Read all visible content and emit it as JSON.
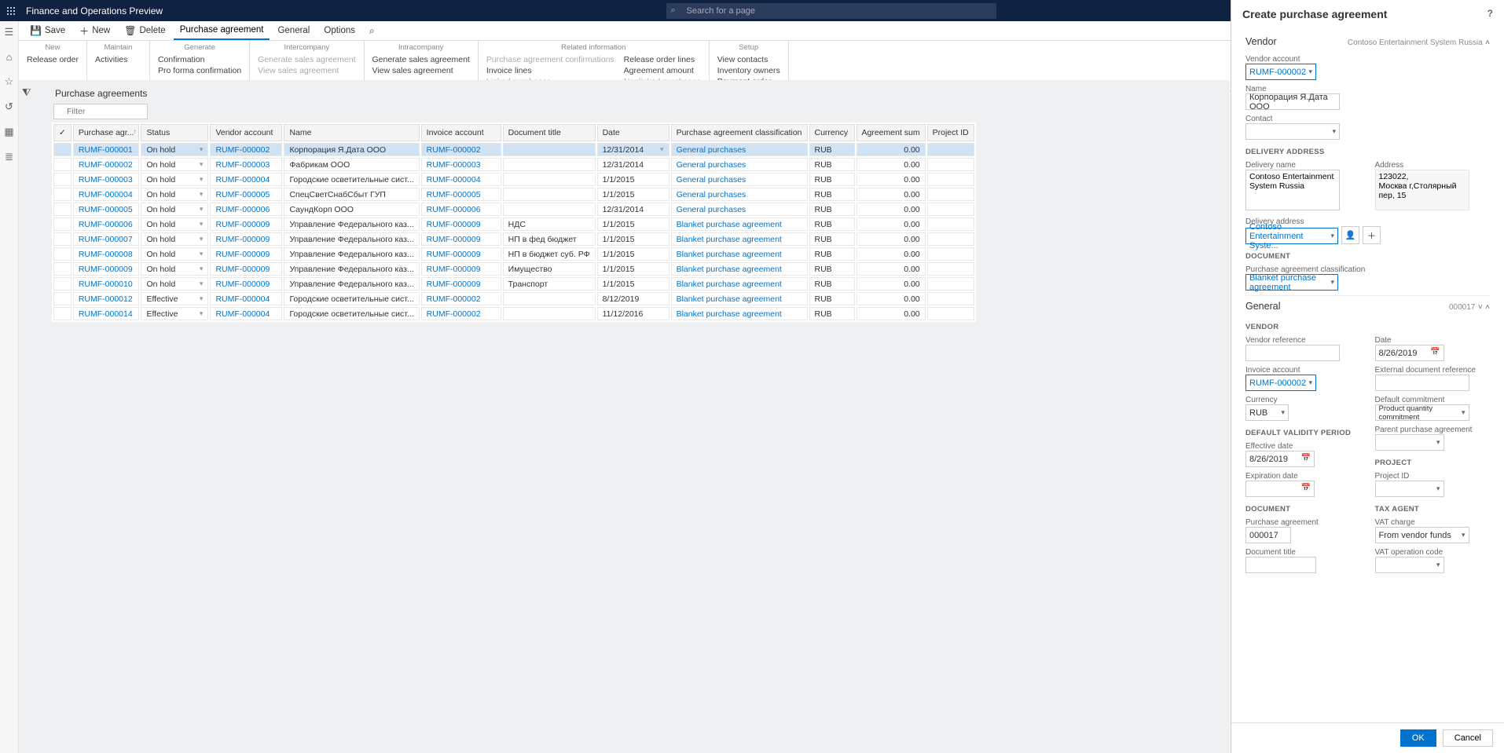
{
  "app_title": "Finance and Operations Preview",
  "search_placeholder": "Search for a page",
  "actions": {
    "save": "Save",
    "new": "New",
    "delete": "Delete",
    "pa": "Purchase agreement",
    "general": "General",
    "options": "Options"
  },
  "ribbon": [
    {
      "head": "New",
      "items": [
        "Release order"
      ]
    },
    {
      "head": "Maintain",
      "items": [
        "Activities"
      ]
    },
    {
      "head": "Generate",
      "items": [
        "Confirmation",
        "Pro forma confirmation"
      ]
    },
    {
      "head": "Intercompany",
      "items": [
        "Generate sales agreement",
        "View sales agreement"
      ],
      "muted": true
    },
    {
      "head": "Intracompany",
      "items": [
        "Generate sales agreement",
        "View sales agreement"
      ]
    },
    {
      "head": "Related information",
      "items": [
        "Purchase agreement confirmations",
        "Release order lines",
        "Invoice lines",
        "Agreement amount",
        "Linked purchases",
        "Nonlinked purchases"
      ],
      "cols": 2,
      "muted_idx": [
        0,
        4,
        5
      ]
    },
    {
      "head": "Setup",
      "items": [
        "View contacts",
        "Inventory owners",
        "Payment order"
      ]
    }
  ],
  "page_title": "Purchase agreements",
  "filter_placeholder": "Filter",
  "columns": [
    "Purchase agr...",
    "Status",
    "Vendor account",
    "Name",
    "Invoice account",
    "Document title",
    "Date",
    "Purchase agreement classification",
    "Currency",
    "Agreement sum",
    "Project ID"
  ],
  "rows": [
    {
      "id": "RUMF-000001",
      "status": "On hold",
      "vend": "RUMF-000002",
      "name": "Корпорация Я.Дата ООО",
      "inv": "RUMF-000002",
      "doc": "",
      "date": "12/31/2014",
      "cls": "General purchases",
      "cur": "RUB",
      "sum": "0.00",
      "sel": true
    },
    {
      "id": "RUMF-000002",
      "status": "On hold",
      "vend": "RUMF-000003",
      "name": "Фабрикам ООО",
      "inv": "RUMF-000003",
      "doc": "",
      "date": "12/31/2014",
      "cls": "General purchases",
      "cur": "RUB",
      "sum": "0.00"
    },
    {
      "id": "RUMF-000003",
      "status": "On hold",
      "vend": "RUMF-000004",
      "name": "Городские осветительные сист...",
      "inv": "RUMF-000004",
      "doc": "",
      "date": "1/1/2015",
      "cls": "General purchases",
      "cur": "RUB",
      "sum": "0.00"
    },
    {
      "id": "RUMF-000004",
      "status": "On hold",
      "vend": "RUMF-000005",
      "name": "СпецСветСнабСбыт ГУП",
      "inv": "RUMF-000005",
      "doc": "",
      "date": "1/1/2015",
      "cls": "General purchases",
      "cur": "RUB",
      "sum": "0.00"
    },
    {
      "id": "RUMF-000005",
      "status": "On hold",
      "vend": "RUMF-000006",
      "name": "СаундКорп ООО",
      "inv": "RUMF-000006",
      "doc": "",
      "date": "12/31/2014",
      "cls": "General purchases",
      "cur": "RUB",
      "sum": "0.00"
    },
    {
      "id": "RUMF-000006",
      "status": "On hold",
      "vend": "RUMF-000009",
      "name": "Управление Федерального каз...",
      "inv": "RUMF-000009",
      "doc": "НДС",
      "date": "1/1/2015",
      "cls": "Blanket purchase agreement",
      "cur": "RUB",
      "sum": "0.00"
    },
    {
      "id": "RUMF-000007",
      "status": "On hold",
      "vend": "RUMF-000009",
      "name": "Управление Федерального каз...",
      "inv": "RUMF-000009",
      "doc": "НП в фед бюджет",
      "date": "1/1/2015",
      "cls": "Blanket purchase agreement",
      "cur": "RUB",
      "sum": "0.00"
    },
    {
      "id": "RUMF-000008",
      "status": "On hold",
      "vend": "RUMF-000009",
      "name": "Управление Федерального каз...",
      "inv": "RUMF-000009",
      "doc": "НП в бюджет суб. РФ",
      "date": "1/1/2015",
      "cls": "Blanket purchase agreement",
      "cur": "RUB",
      "sum": "0.00"
    },
    {
      "id": "RUMF-000009",
      "status": "On hold",
      "vend": "RUMF-000009",
      "name": "Управление Федерального каз...",
      "inv": "RUMF-000009",
      "doc": "Имущество",
      "date": "1/1/2015",
      "cls": "Blanket purchase agreement",
      "cur": "RUB",
      "sum": "0.00"
    },
    {
      "id": "RUMF-000010",
      "status": "On hold",
      "vend": "RUMF-000009",
      "name": "Управление Федерального каз...",
      "inv": "RUMF-000009",
      "doc": "Транспорт",
      "date": "1/1/2015",
      "cls": "Blanket purchase agreement",
      "cur": "RUB",
      "sum": "0.00"
    },
    {
      "id": "RUMF-000012",
      "status": "Effective",
      "vend": "RUMF-000004",
      "name": "Городские осветительные сист...",
      "inv": "RUMF-000002",
      "doc": "",
      "date": "8/12/2019",
      "cls": "Blanket purchase agreement",
      "cur": "RUB",
      "sum": "0.00"
    },
    {
      "id": "RUMF-000014",
      "status": "Effective",
      "vend": "RUMF-000004",
      "name": "Городские осветительные сист...",
      "inv": "RUMF-000002",
      "doc": "",
      "date": "11/12/2016",
      "cls": "Blanket purchase agreement",
      "cur": "RUB",
      "sum": "0.00"
    }
  ],
  "panel": {
    "title": "Create purchase agreement",
    "vendor_section": "Vendor",
    "vendor_subtitle": "Contoso Entertainment System Russia",
    "vendor_account_lbl": "Vendor account",
    "vendor_account": "RUMF-000002",
    "name_lbl": "Name",
    "name": "Корпорация Я.Дата ООО",
    "contact_lbl": "Contact",
    "delivery_h": "DELIVERY ADDRESS",
    "delivery_name_lbl": "Delivery name",
    "delivery_name": "Contoso Entertainment System Russia",
    "address_lbl": "Address",
    "address": "123022,\nМосква г,Столярный пер, 15",
    "delivery_addr_lbl": "Delivery address",
    "delivery_addr": "Contoso Entertainment Syste...",
    "document_h": "DOCUMENT",
    "pa_class_lbl": "Purchase agreement classification",
    "pa_class": "Blanket purchase agreement",
    "general_section": "General",
    "general_sub": "000017",
    "vendor_h": "VENDOR",
    "vendor_ref_lbl": "Vendor reference",
    "invoice_acc_lbl": "Invoice account",
    "invoice_acc": "RUMF-000002",
    "currency_lbl": "Currency",
    "currency": "RUB",
    "date_lbl": "Date",
    "date": "8/26/2019",
    "ext_ref_lbl": "External document reference",
    "def_commit_lbl": "Default commitment",
    "def_commit": "Product quantity commitment",
    "parent_pa_lbl": "Parent purchase agreement",
    "validity_h": "DEFAULT VALIDITY PERIOD",
    "eff_date_lbl": "Effective date",
    "eff_date": "8/26/2019",
    "exp_date_lbl": "Expiration date",
    "doc_h2": "DOCUMENT",
    "pa_lbl": "Purchase agreement",
    "pa_val": "000017",
    "doc_title_lbl": "Document title",
    "project_h": "PROJECT",
    "project_id_lbl": "Project ID",
    "tax_h": "TAX AGENT",
    "vat_charge_lbl": "VAT charge",
    "vat_charge": "From vendor funds",
    "vat_op_lbl": "VAT operation code",
    "ok": "OK",
    "cancel": "Cancel"
  }
}
